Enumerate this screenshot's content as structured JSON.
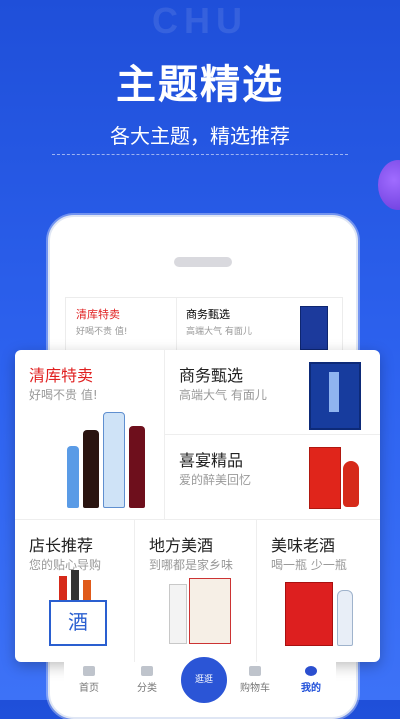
{
  "watermark": "CHU",
  "headline": "主题精选",
  "subline": "各大主题，精选推荐",
  "colors": {
    "accent_red": "#e02020",
    "brand_blue": "#1f4fd9"
  },
  "phone_preview": {
    "left": {
      "title": "清库特卖",
      "subtitle": "好喝不贵 值!"
    },
    "right": {
      "title": "商务甄选",
      "subtitle": "高端大气 有面儿"
    }
  },
  "card": {
    "clearance": {
      "title": "清库特卖",
      "subtitle": "好喝不贵 值!"
    },
    "business": {
      "title": "商务甄选",
      "subtitle": "高端大气 有面儿"
    },
    "banquet": {
      "title": "喜宴精品",
      "subtitle": "爱的醉美回忆"
    },
    "manager": {
      "title": "店长推荐",
      "subtitle": "您的贴心导购"
    },
    "local": {
      "title": "地方美酒",
      "subtitle": "到哪都是家乡味"
    },
    "aged": {
      "title": "美味老酒",
      "subtitle": "喝一瓶 少一瓶"
    },
    "box_char": "酒"
  },
  "tabbar": {
    "items": [
      {
        "label": "首页",
        "icon": "home-icon"
      },
      {
        "label": "分类",
        "icon": "grid-icon"
      },
      {
        "label": "购物车",
        "icon": "cart-icon"
      },
      {
        "label": "我的",
        "icon": "user-icon"
      }
    ],
    "center_label": "逛逛"
  }
}
